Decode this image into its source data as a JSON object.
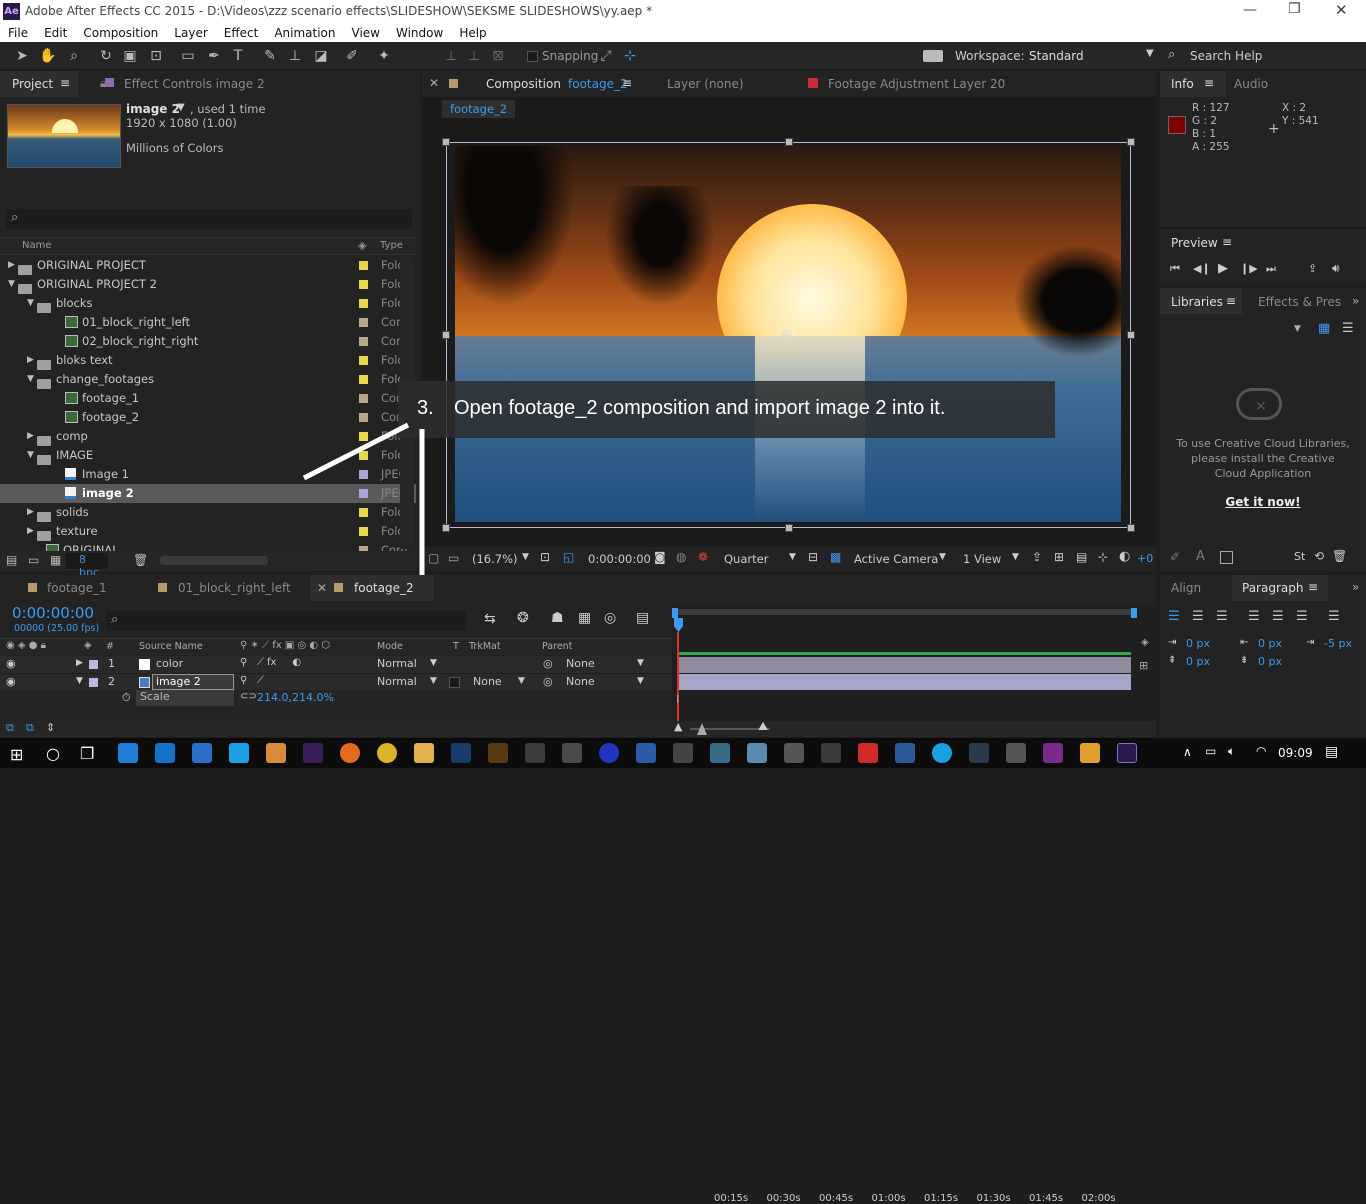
{
  "window": {
    "title": "Adobe After Effects CC 2015 - D:\\Videos\\zzz scenario effects\\SLIDESHOW\\SEKSME SLIDESHOWS\\yy.aep *",
    "app_icon": "Ae"
  },
  "menu": [
    "File",
    "Edit",
    "Composition",
    "Layer",
    "Effect",
    "Animation",
    "View",
    "Window",
    "Help"
  ],
  "toolbar": {
    "snapping_label": "Snapping",
    "workspace_label": "Workspace:",
    "workspace_value": "Standard",
    "search_label": "Search Help"
  },
  "project_panel": {
    "tab_project": "Project",
    "tab_effect_controls": "Effect Controls image 2",
    "item_name": "image 2",
    "item_used": ", used 1 time",
    "item_dims": "1920 x 1080 (1.00)",
    "item_colors": "Millions of Colors",
    "search_glyph": "⌕",
    "col_name": "Name",
    "col_type": "Type",
    "bpc": "8 bpc",
    "rows": [
      {
        "label": "ORIGINAL PROJECT",
        "type": "Fold"
      },
      {
        "label": "ORIGINAL PROJECT 2",
        "type": "Fold"
      },
      {
        "label": "blocks",
        "type": "Fold"
      },
      {
        "label": "01_block_right_left",
        "type": "Com"
      },
      {
        "label": "02_block_right_right",
        "type": "Com"
      },
      {
        "label": "bloks text",
        "type": "Fold"
      },
      {
        "label": "change_footages",
        "type": "Fold"
      },
      {
        "label": "footage_1",
        "type": "Com"
      },
      {
        "label": "footage_2",
        "type": "Com"
      },
      {
        "label": "comp",
        "type": "Fold"
      },
      {
        "label": "IMAGE",
        "type": "Fold"
      },
      {
        "label": "Image 1",
        "type": "JPEG"
      },
      {
        "label": "image 2",
        "type": "JPEG"
      },
      {
        "label": "solids",
        "type": "Fold"
      },
      {
        "label": "texture",
        "type": "Fold"
      },
      {
        "label": "ORIGINAL",
        "type": "Com"
      }
    ]
  },
  "comp_panel": {
    "tab_composition_prefix": "Composition",
    "tab_composition_name": "footage_2",
    "tab_layer": "Layer (none)",
    "tab_footage": "Footage Adjustment Layer 20",
    "breadcrumb": "footage_2",
    "zoom": "(16.7%)",
    "timecode": "0:00:00:00",
    "resolution": "Quarter",
    "camera": "Active Camera",
    "views": "1 View",
    "offset": "+0"
  },
  "annotation": {
    "number": "3.",
    "text": "Open footage_2 composition and import image 2 into it."
  },
  "info_panel": {
    "tab_info": "Info",
    "tab_audio": "Audio",
    "r": "R : 127",
    "g": "G : 2",
    "b": "B : 1",
    "a": "A : 255",
    "x": "X : 2",
    "y": "Y : 541",
    "swatch_color": "#7f0201"
  },
  "preview_panel": {
    "title": "Preview"
  },
  "libraries_panel": {
    "tab_libraries": "Libraries",
    "tab_effects": "Effects & Pres",
    "message": "To use Creative Cloud Libraries, please install the Creative Cloud Application",
    "link": "Get it now!"
  },
  "paragraph_panel": {
    "tab_align": "Align",
    "tab_paragraph": "Paragraph",
    "indent_left": "0 px",
    "indent_right": "0 px",
    "indent_first": "-5 px",
    "space_before": "0 px",
    "space_after": "0 px"
  },
  "timeline": {
    "tabs": [
      "footage_1",
      "01_block_right_left",
      "footage_2"
    ],
    "timecode": "0:00:00:00",
    "frames": "00000 (25.00 fps)",
    "col_source": "Source Name",
    "col_mode": "Mode",
    "col_t": "T",
    "col_trkmat": "TrkMat",
    "col_parent": "Parent",
    "ticks": [
      "00:15s",
      "00:30s",
      "00:45s",
      "01:00s",
      "01:15s",
      "01:30s",
      "01:45s",
      "02:00s"
    ],
    "layers": [
      {
        "num": "1",
        "name": "color",
        "mode": "Normal",
        "trkmat": "",
        "parent": "None"
      },
      {
        "num": "2",
        "name": "image 2",
        "mode": "Normal",
        "trkmat": "None",
        "parent": "None"
      }
    ],
    "scale_label": "Scale",
    "scale_value": "214.0,214.0%"
  },
  "taskbar": {
    "time": "09:09"
  }
}
